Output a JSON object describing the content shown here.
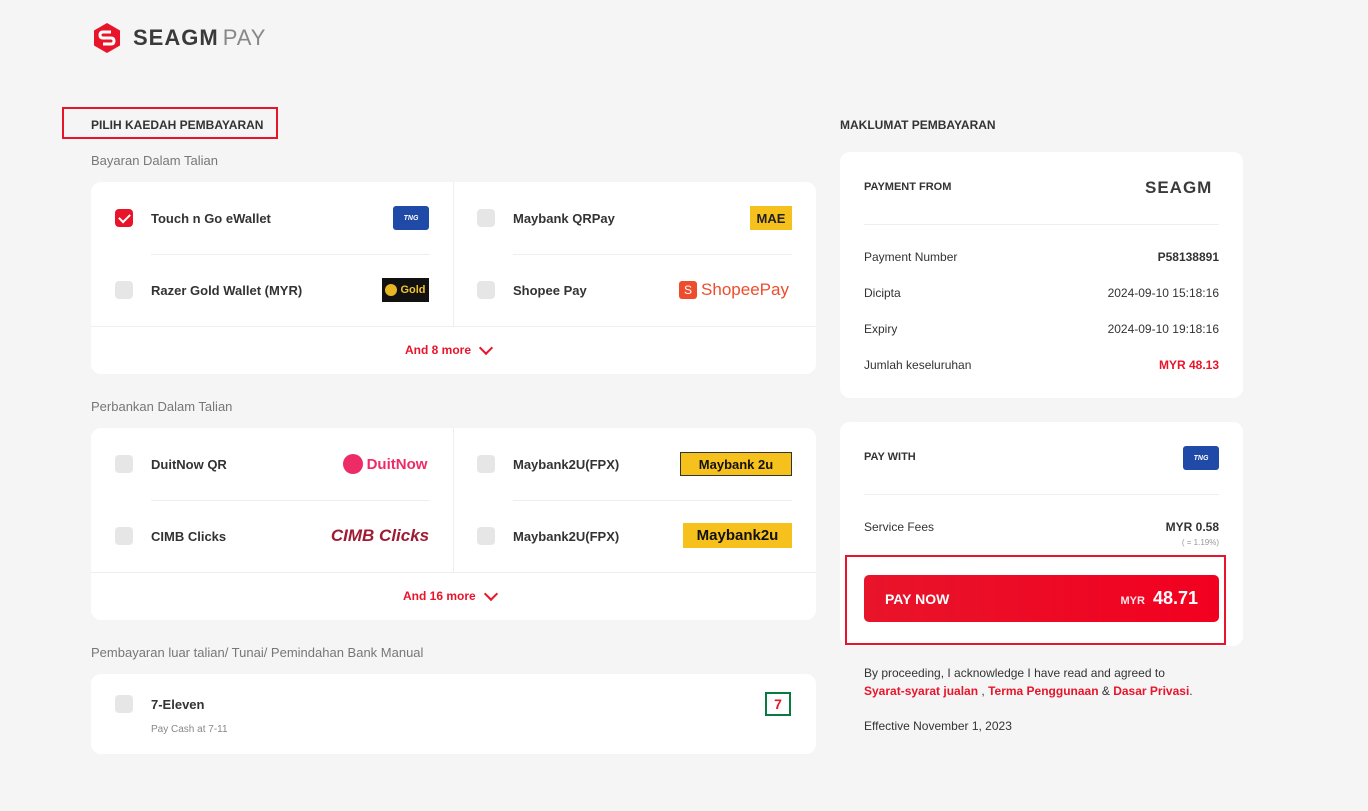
{
  "brand": {
    "name": "SEAGM",
    "suffix": "PAY"
  },
  "left": {
    "title": "PILIH KAEDAH PEMBAYARAN",
    "groups": [
      {
        "subtitle": "Bayaran Dalam Talian",
        "options": [
          {
            "label": "Touch n Go eWallet",
            "checked": true,
            "logo": "TNG"
          },
          {
            "label": "Maybank QRPay",
            "checked": false,
            "logo": "MAE"
          },
          {
            "label": "Razer Gold Wallet (MYR)",
            "checked": false,
            "logo": "Gold"
          },
          {
            "label": "Shopee Pay",
            "checked": false,
            "logo": "ShopeePay"
          }
        ],
        "more": "And 8 more"
      },
      {
        "subtitle": "Perbankan Dalam Talian",
        "options": [
          {
            "label": "DuitNow QR",
            "checked": false,
            "logo": "DuitNow"
          },
          {
            "label": "Maybank2U(FPX)",
            "checked": false,
            "logo": "Maybank 2u"
          },
          {
            "label": "CIMB Clicks",
            "checked": false,
            "logo": "CIMB Clicks"
          },
          {
            "label": "Maybank2U(FPX)",
            "checked": false,
            "logo": "Maybank2u"
          }
        ],
        "more": "And 16 more"
      },
      {
        "subtitle": "Pembayaran luar talian/ Tunai/ Pemindahan Bank Manual",
        "options": [
          {
            "label": "7-Eleven",
            "desc": "Pay Cash at 7-11",
            "checked": false,
            "logo": "7"
          }
        ]
      }
    ]
  },
  "right": {
    "title": "MAKLUMAT PEMBAYARAN",
    "payment_from": {
      "heading": "PAYMENT FROM",
      "rows": [
        {
          "label": "Payment Number",
          "value": "P58138891"
        },
        {
          "label": "Dicipta",
          "value": "2024-09-10 15:18:16"
        },
        {
          "label": "Expiry",
          "value": "2024-09-10 19:18:16"
        },
        {
          "label": "Jumlah keseluruhan",
          "value": "MYR 48.13"
        }
      ]
    },
    "pay_with": {
      "heading": "PAY WITH",
      "fee_label": "Service Fees",
      "fee_value": "MYR 0.58",
      "fee_pct": "( = 1.19%)",
      "button_label": "PAY NOW",
      "button_currency": "MYR",
      "button_amount": "48.71"
    },
    "terms": {
      "prefix": "By proceeding, I acknowledge I have read and agreed to",
      "link1": "Syarat-syarat jualan",
      "sep1": " , ",
      "link2": "Terma Penggunaan",
      "sep2": " & ",
      "link3": "Dasar Privasi",
      "end": ".",
      "effective": "Effective November 1, 2023"
    }
  },
  "colors": {
    "accent": "#e8142a",
    "bg": "#f5f5f5"
  }
}
